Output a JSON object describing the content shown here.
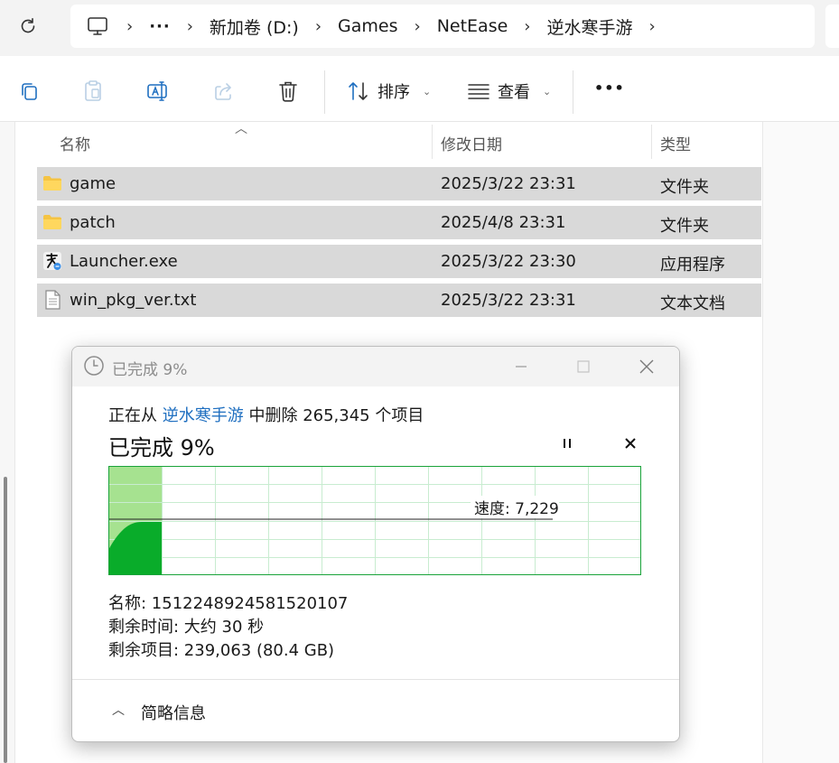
{
  "address_bar": {
    "ellipsis": "···",
    "crumbs": [
      "新加卷 (D:)",
      "Games",
      "NetEase",
      "逆水寒手游"
    ]
  },
  "toolbar": {
    "sort_label": "排序",
    "view_label": "查看",
    "more_label": "•••"
  },
  "file_list": {
    "columns": {
      "name": "名称",
      "date": "修改日期",
      "type": "类型"
    },
    "rows": [
      {
        "name": "game",
        "date": "2025/3/22 23:31",
        "type": "文件夹",
        "icon": "folder-icon"
      },
      {
        "name": "patch",
        "date": "2025/4/8 23:31",
        "type": "文件夹",
        "icon": "folder-icon"
      },
      {
        "name": "Launcher.exe",
        "date": "2025/3/22 23:30",
        "type": "应用程序",
        "icon": "launcher-app-icon"
      },
      {
        "name": "win_pkg_ver.txt",
        "date": "2025/3/22 23:31",
        "type": "文本文档",
        "icon": "text-file-icon"
      }
    ]
  },
  "dialog": {
    "title": "已完成 9%",
    "line1_prefix": "正在从",
    "line1_location": "逆水寒手游",
    "line1_suffix": "中删除 265,345 个项目",
    "percent_text": "已完成 9%",
    "progress": 0.09,
    "speed_text": "速度: 7,229",
    "name_line": "名称: 1512248924581520107",
    "time_line": "剩余时间: 大约 30 秒",
    "items_line": "剩余项目: 239,063 (80.4 GB)",
    "collapse_label": "简略信息",
    "colors": {
      "graph_border": "#1aa33a",
      "graph_grid": "#c8ecd0",
      "progress_fill": "#a6e290",
      "speed_fill": "#09ac2a",
      "link": "#1f6fc0"
    }
  }
}
